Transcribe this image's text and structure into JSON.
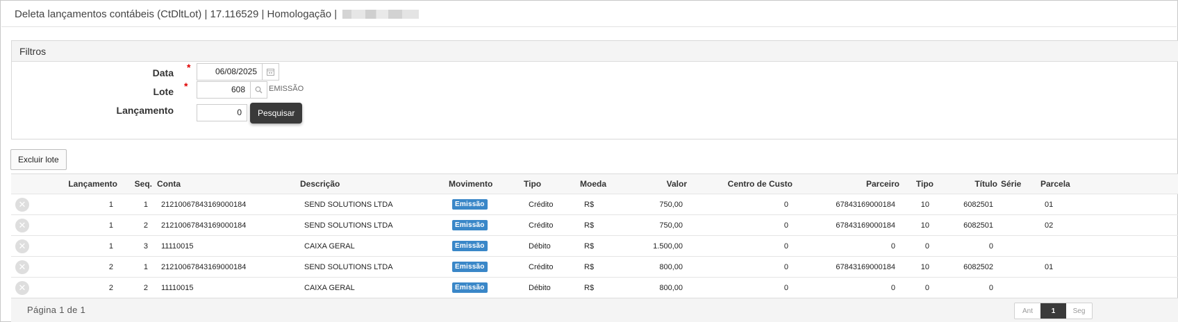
{
  "window": {
    "title": "Deleta lançamentos contábeis (CtDltLot) | 17.116529 | Homologação |"
  },
  "filters": {
    "title": "Filtros",
    "data_label": "Data",
    "data_value": "06/08/2025",
    "lote_label": "Lote",
    "lote_value": "608",
    "lote_hint": "EMISSÃO",
    "lancamento_label": "Lançamento",
    "lancamento_value": "0",
    "search_button": "Pesquisar",
    "required_mark": "*"
  },
  "toolbar": {
    "delete_lot_button": "Excluir lote"
  },
  "table": {
    "columns": {
      "lancamento": "Lançamento",
      "seq": "Seq.",
      "conta": "Conta",
      "descricao": "Descrição",
      "movimento": "Movimento",
      "tipo": "Tipo",
      "moeda": "Moeda",
      "valor": "Valor",
      "centro": "Centro de Custo",
      "parceiro": "Parceiro",
      "tipo2": "Tipo",
      "titulo": "Título",
      "serie": "Série",
      "parcela": "Parcela"
    },
    "rows": [
      {
        "lancamento": "1",
        "seq": "1",
        "conta": "21210067843169000184",
        "descricao": "SEND SOLUTIONS LTDA",
        "movimento": "Emissão",
        "tipo": "Crédito",
        "moeda": "R$",
        "valor": "750,00",
        "centro": "0",
        "parceiro": "67843169000184",
        "tipo2": "10",
        "titulo": "6082501",
        "serie": "",
        "parcela": "01"
      },
      {
        "lancamento": "1",
        "seq": "2",
        "conta": "21210067843169000184",
        "descricao": "SEND SOLUTIONS LTDA",
        "movimento": "Emissão",
        "tipo": "Crédito",
        "moeda": "R$",
        "valor": "750,00",
        "centro": "0",
        "parceiro": "67843169000184",
        "tipo2": "10",
        "titulo": "6082501",
        "serie": "",
        "parcela": "02"
      },
      {
        "lancamento": "1",
        "seq": "3",
        "conta": "11110015",
        "descricao": "CAIXA GERAL",
        "movimento": "Emissão",
        "tipo": "Débito",
        "moeda": "R$",
        "valor": "1.500,00",
        "centro": "0",
        "parceiro": "0",
        "tipo2": "0",
        "titulo": "0",
        "serie": "",
        "parcela": ""
      },
      {
        "lancamento": "2",
        "seq": "1",
        "conta": "21210067843169000184",
        "descricao": "SEND SOLUTIONS LTDA",
        "movimento": "Emissão",
        "tipo": "Crédito",
        "moeda": "R$",
        "valor": "800,00",
        "centro": "0",
        "parceiro": "67843169000184",
        "tipo2": "10",
        "titulo": "6082502",
        "serie": "",
        "parcela": "01"
      },
      {
        "lancamento": "2",
        "seq": "2",
        "conta": "11110015",
        "descricao": "CAIXA GERAL",
        "movimento": "Emissão",
        "tipo": "Débito",
        "moeda": "R$",
        "valor": "800,00",
        "centro": "0",
        "parceiro": "0",
        "tipo2": "0",
        "titulo": "0",
        "serie": "",
        "parcela": ""
      }
    ]
  },
  "pagination": {
    "info": "Página 1 de 1",
    "prev": "Ant",
    "current": "1",
    "next": "Seg"
  },
  "icons": {
    "calendar": "calendar-icon",
    "search": "search-icon",
    "delete": "close-icon"
  },
  "colors": {
    "badge": "#3a87c8",
    "dark_button": "#3a3a3a",
    "required": "#e00000"
  }
}
